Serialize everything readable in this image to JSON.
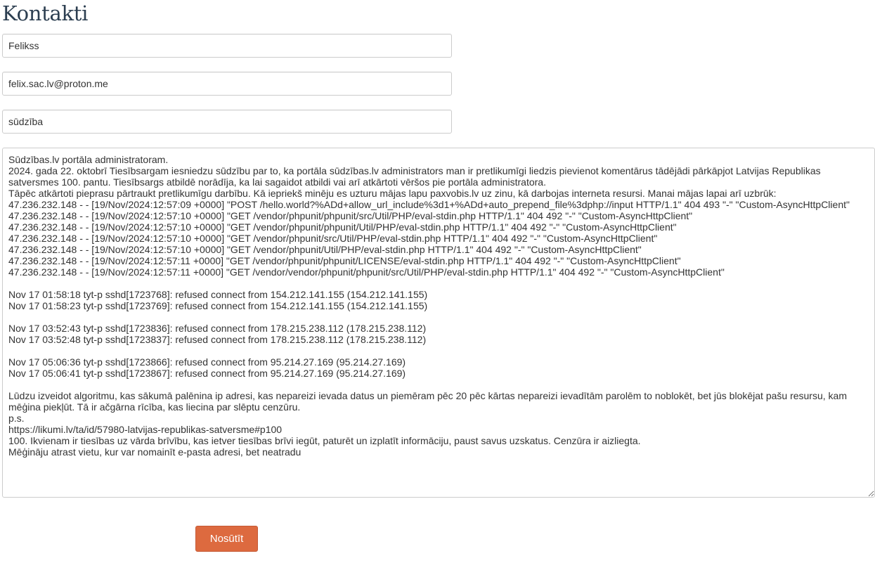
{
  "page": {
    "title": "Kontakti"
  },
  "form": {
    "name_value": "Felikss",
    "email_value": "felix.sac.lv@proton.me",
    "subject_value": "sūdzība",
    "message_value": "Sūdzības.lv portāla administratoram.\n2024. gada 22. oktobrī Tiesībsargam iesniedzu sūdzību par to, ka portāla sūdzības.lv administrators man ir pretlikumīgi liedzis pievienot komentārus tādējādi pārkāpjot Latvijas Republikas satversmes 100. pantu. Tiesībsargs atbildē norādīja, ka lai sagaidot atbildi vai arī atkārtoti vēršos pie portāla administratora.\nTāpēc atkārtoti pieprasu pārtraukt pretlikumīgu darbību. Kā iepriekš minēju es uzturu mājas lapu paxvobis.lv uz zinu, kā darbojas interneta resursi. Manai mājas lapai arī uzbrūk:\n47.236.232.148 - - [19/Nov/2024:12:57:09 +0000] \"POST /hello.world?%ADd+allow_url_include%3d1+%ADd+auto_prepend_file%3dphp://input HTTP/1.1\" 404 493 \"-\" \"Custom-AsyncHttpClient\"\n47.236.232.148 - - [19/Nov/2024:12:57:10 +0000] \"GET /vendor/phpunit/phpunit/src/Util/PHP/eval-stdin.php HTTP/1.1\" 404 492 \"-\" \"Custom-AsyncHttpClient\"\n47.236.232.148 - - [19/Nov/2024:12:57:10 +0000] \"GET /vendor/phpunit/phpunit/Util/PHP/eval-stdin.php HTTP/1.1\" 404 492 \"-\" \"Custom-AsyncHttpClient\"\n47.236.232.148 - - [19/Nov/2024:12:57:10 +0000] \"GET /vendor/phpunit/src/Util/PHP/eval-stdin.php HTTP/1.1\" 404 492 \"-\" \"Custom-AsyncHttpClient\"\n47.236.232.148 - - [19/Nov/2024:12:57:10 +0000] \"GET /vendor/phpunit/Util/PHP/eval-stdin.php HTTP/1.1\" 404 492 \"-\" \"Custom-AsyncHttpClient\"\n47.236.232.148 - - [19/Nov/2024:12:57:11 +0000] \"GET /vendor/phpunit/phpunit/LICENSE/eval-stdin.php HTTP/1.1\" 404 492 \"-\" \"Custom-AsyncHttpClient\"\n47.236.232.148 - - [19/Nov/2024:12:57:11 +0000] \"GET /vendor/vendor/phpunit/phpunit/src/Util/PHP/eval-stdin.php HTTP/1.1\" 404 492 \"-\" \"Custom-AsyncHttpClient\"\n\nNov 17 01:58:18 tyt-p sshd[1723768]: refused connect from 154.212.141.155 (154.212.141.155)\nNov 17 01:58:23 tyt-p sshd[1723769]: refused connect from 154.212.141.155 (154.212.141.155)\n\nNov 17 03:52:43 tyt-p sshd[1723836]: refused connect from 178.215.238.112 (178.215.238.112)\nNov 17 03:52:48 tyt-p sshd[1723837]: refused connect from 178.215.238.112 (178.215.238.112)\n\nNov 17 05:06:36 tyt-p sshd[1723866]: refused connect from 95.214.27.169 (95.214.27.169)\nNov 17 05:06:41 tyt-p sshd[1723867]: refused connect from 95.214.27.169 (95.214.27.169)\n\nLūdzu izveidot algoritmu, kas sākumā palēnina ip adresi, kas nepareizi ievada datus un piemēram pēc 20 pēc kārtas nepareizi ievadītām parolēm to noblokēt, bet jūs blokējat pašu resursu, kam mēģina piekļūt. Tā ir ačgārna rīcība, kas liecina par slēptu cenzūru.\np.s.\nhttps://likumi.lv/ta/id/57980-latvijas-republikas-satversme#p100\n100. Ikvienam ir tiesības uz vārda brīvību, kas ietver tiesības brīvi iegūt, paturēt un izplatīt informāciju, paust savus uzskatus. Cenzūra ir aizliegta.\nMēģināju atrast vietu, kur var nomainīt e-pasta adresi, bet neatradu",
    "submit_label": "Nosūtīt"
  },
  "colors": {
    "title": "#2c3e50",
    "accent_button": "#dd6a3f",
    "field_border": "#cccccc"
  }
}
